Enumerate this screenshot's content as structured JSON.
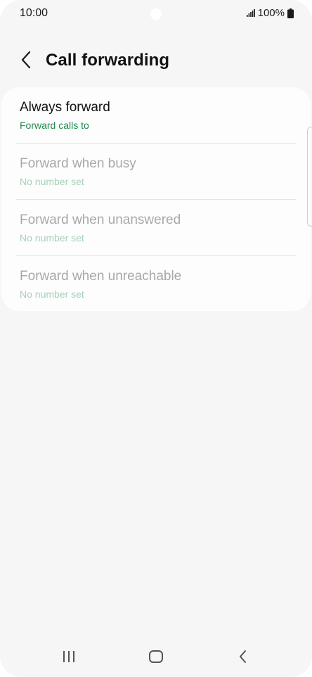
{
  "status_bar": {
    "time": "10:00",
    "battery": "100%",
    "icons": [
      "signal-icon",
      "battery-icon"
    ]
  },
  "header": {
    "back_icon": "back-arrow-icon",
    "title": "Call forwarding"
  },
  "options": [
    {
      "title": "Always forward",
      "subtitle": "Forward calls to",
      "enabled": true
    },
    {
      "title": "Forward when busy",
      "subtitle": "No number set",
      "enabled": false
    },
    {
      "title": "Forward when unanswered",
      "subtitle": "No number set",
      "enabled": false
    },
    {
      "title": "Forward when unreachable",
      "subtitle": "No number set",
      "enabled": false
    }
  ],
  "nav_bar": {
    "icons": [
      "recents-icon",
      "home-icon",
      "back-icon"
    ]
  },
  "colors": {
    "accent": "#1e8a4c",
    "accent_disabled": "#a7d0b8",
    "background": "#f6f6f6",
    "card": "#fdfdfd"
  }
}
